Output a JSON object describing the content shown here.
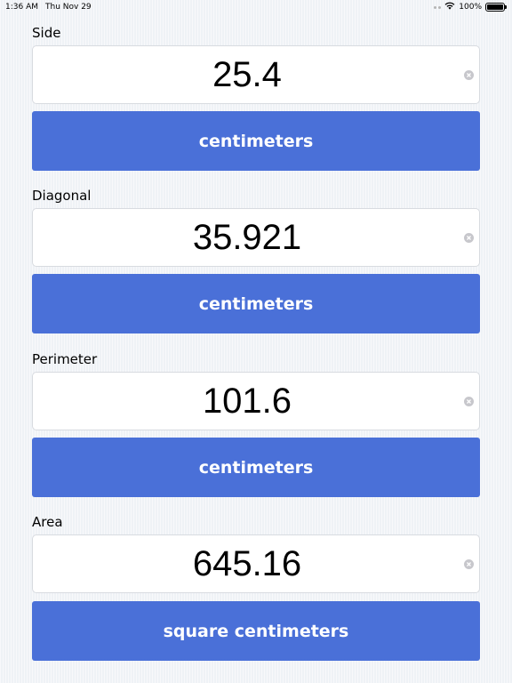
{
  "status_bar": {
    "time": "1:36 AM",
    "date": "Thu Nov 29",
    "battery": "100%",
    "battery_level_percent": 100
  },
  "sections": [
    {
      "label": "Side",
      "value": "25.4",
      "unit": "centimeters"
    },
    {
      "label": "Diagonal",
      "value": "35.921",
      "unit": "centimeters"
    },
    {
      "label": "Perimeter",
      "value": "101.6",
      "unit": "centimeters"
    },
    {
      "label": "Area",
      "value": "645.16",
      "unit": "square centimeters"
    }
  ],
  "icons": {
    "clear": "clear-circle-icon",
    "wifi": "wifi-icon",
    "battery": "battery-icon"
  },
  "colors": {
    "button": "#4a70d8",
    "button_text": "#ffffff",
    "background": "#eff2f6"
  }
}
